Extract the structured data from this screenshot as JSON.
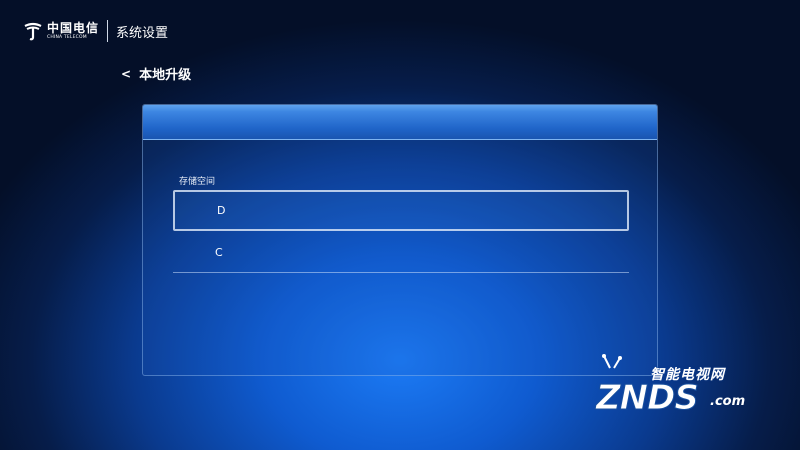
{
  "header": {
    "logo_cn": "中国电信",
    "logo_en": "CHINA TELECOM",
    "title": "系统设置"
  },
  "breadcrumb": {
    "back_icon": "<",
    "title": "本地升级"
  },
  "panel": {
    "section_label": "存储空间",
    "items": [
      {
        "label": "D",
        "selected": true
      },
      {
        "label": "C",
        "selected": false
      }
    ]
  },
  "watermark": {
    "cn": "智能电视网",
    "en": "ZNDS",
    "suffix": ".com"
  },
  "icons": {
    "logo": "china-telecom-logo-icon",
    "back": "chevron-left-icon",
    "watermark": "tv-icon"
  }
}
